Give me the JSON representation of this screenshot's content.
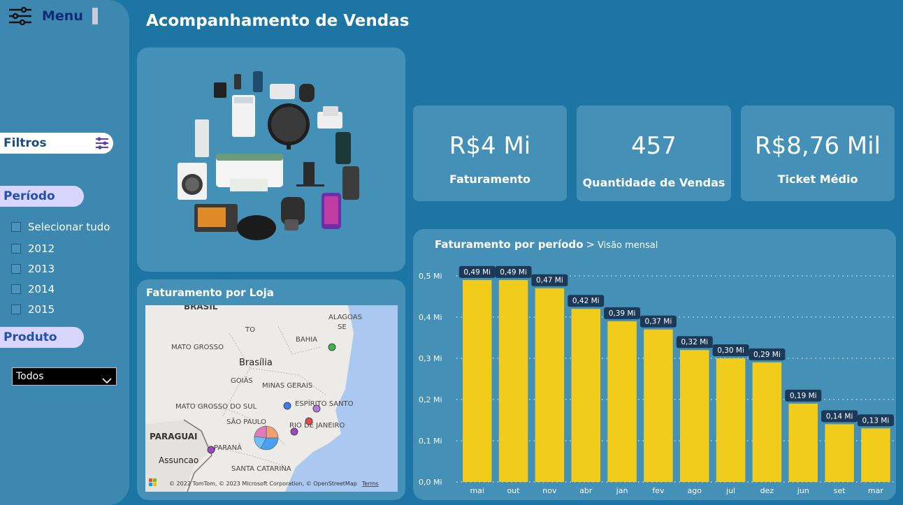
{
  "app": {
    "title": "Acompanhamento de Vendas"
  },
  "sidebar": {
    "menu_label": "Menu",
    "filtros_label": "Filtros",
    "periodo_label": "Período",
    "periodo_options": [
      "Selecionar tudo",
      "2012",
      "2013",
      "2014",
      "2015"
    ],
    "produto_label": "Produto",
    "produto_selected": "Todos"
  },
  "kpis": [
    {
      "value": "R$4 Mi",
      "label": "Faturamento"
    },
    {
      "value": "457",
      "label": "Quantidade de Vendas"
    },
    {
      "value": "R$8,76 Mil",
      "label": "Ticket Médio"
    }
  ],
  "map": {
    "title": "Faturamento por Loja",
    "labels": [
      "BRASIL",
      "ALAGOAS",
      "SE",
      "TO",
      "BAHIA",
      "MATO GROSSO",
      "Brasília",
      "GOIÁS",
      "MINAS GERAIS",
      "MATO GROSSO DO SUL",
      "ESPÍRITO SANTO",
      "SÃO PAULO",
      "RIO DE JANEIRO",
      "PARAGUAI",
      "PARANÁ",
      "Assuncao",
      "SANTA CATARINA"
    ],
    "attribution": "© 2022 TomTom, © 2023 Microsoft Corporation, © OpenStreetMap",
    "terms": "Terms"
  },
  "chart_data": {
    "type": "bar",
    "title": "Faturamento por período",
    "subtitle": "Visão mensal",
    "categories": [
      "mai",
      "out",
      "nov",
      "abr",
      "jan",
      "fev",
      "ago",
      "jul",
      "dez",
      "jun",
      "set",
      "mar"
    ],
    "values": [
      0.49,
      0.49,
      0.47,
      0.42,
      0.39,
      0.37,
      0.32,
      0.3,
      0.29,
      0.19,
      0.14,
      0.13
    ],
    "data_labels": [
      "0,49 Mi",
      "0,49 Mi",
      "0,47 Mi",
      "0,42 Mi",
      "0,39 Mi",
      "0,37 Mi",
      "0,32 Mi",
      "0,30 Mi",
      "0,29 Mi",
      "0,19 Mi",
      "0,14 Mi",
      "0,13 Mi"
    ],
    "y_ticks": [
      0,
      0.1,
      0.2,
      0.3,
      0.4,
      0.5
    ],
    "y_tick_labels": [
      "0,0 Mi",
      "0,1 Mi",
      "0,2 Mi",
      "0,3 Mi",
      "0,4 Mi",
      "0,5 Mi"
    ],
    "ylim": [
      0,
      0.5
    ],
    "grid": true,
    "bar_color": "#f2cc1b"
  }
}
